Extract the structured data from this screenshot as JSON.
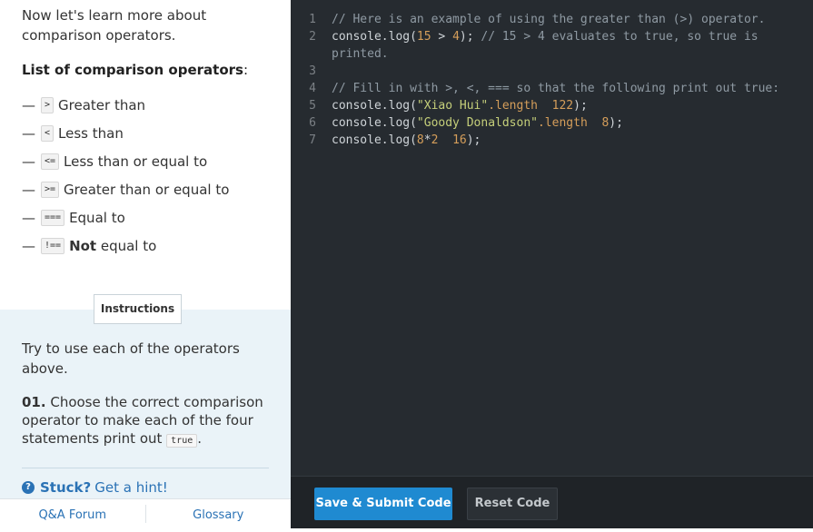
{
  "lesson": {
    "intro": "Now let's learn more about comparison operators.",
    "list_title": "List of comparison operators",
    "list_title_colon": ":",
    "operators": [
      {
        "symbol": ">",
        "label": "Greater than"
      },
      {
        "symbol": "<",
        "label": "Less than"
      },
      {
        "symbol": "<=",
        "label": "Less than or equal to"
      },
      {
        "symbol": ">=",
        "label": "Greater than or equal to"
      },
      {
        "symbol": "===",
        "label": "Equal to"
      },
      {
        "symbol": "!==",
        "label_bold": "Not",
        "label": " equal to"
      }
    ]
  },
  "instructions": {
    "tab_label": "Instructions",
    "text": "Try to use each of the operators above.",
    "step_number": "01.",
    "step_text": " Choose the correct comparison operator to make each of the four statements print out ",
    "step_code": "true",
    "step_end": "."
  },
  "hint": {
    "icon": "?",
    "bold": "Stuck?",
    "text": "Get a hint!"
  },
  "footer": {
    "qa_label": "Q&A Forum",
    "glossary_label": "Glossary"
  },
  "editor": {
    "lines": [
      {
        "n": "1",
        "tokens": [
          {
            "t": "// Here is an example of using the greater than (>) operator.",
            "c": "c-com"
          }
        ]
      },
      {
        "n": "2",
        "tokens": [
          {
            "t": "console.log(",
            "c": "c-fn"
          },
          {
            "t": "15",
            "c": "c-num"
          },
          {
            "t": " > ",
            "c": "c-fn"
          },
          {
            "t": "4",
            "c": "c-num"
          },
          {
            "t": "); ",
            "c": "c-fn"
          },
          {
            "t": "// 15 > 4 evaluates to true, so true is",
            "c": "c-com"
          }
        ]
      },
      {
        "n": "",
        "tokens": [
          {
            "t": "printed.",
            "c": "c-com"
          }
        ]
      },
      {
        "n": "3",
        "tokens": [
          {
            "t": "",
            "c": "c-fn"
          }
        ]
      },
      {
        "n": "4",
        "tokens": [
          {
            "t": "// Fill in with >, <, === so that the following print out true:",
            "c": "c-com"
          }
        ]
      },
      {
        "n": "5",
        "tokens": [
          {
            "t": "console.log(",
            "c": "c-fn"
          },
          {
            "t": "\"Xiao Hui\"",
            "c": "c-str"
          },
          {
            "t": ".length",
            "c": "c-prop"
          },
          {
            "t": "  ",
            "c": "c-fn"
          },
          {
            "t": "122",
            "c": "c-num"
          },
          {
            "t": ");",
            "c": "c-fn"
          }
        ]
      },
      {
        "n": "6",
        "tokens": [
          {
            "t": "console.log(",
            "c": "c-fn"
          },
          {
            "t": "\"Goody Donaldson\"",
            "c": "c-str"
          },
          {
            "t": ".length",
            "c": "c-prop"
          },
          {
            "t": "  ",
            "c": "c-fn"
          },
          {
            "t": "8",
            "c": "c-num"
          },
          {
            "t": ");",
            "c": "c-fn"
          }
        ]
      },
      {
        "n": "7",
        "tokens": [
          {
            "t": "console.log(",
            "c": "c-fn"
          },
          {
            "t": "8",
            "c": "c-num"
          },
          {
            "t": "*",
            "c": "c-fn"
          },
          {
            "t": "2",
            "c": "c-num"
          },
          {
            "t": "  ",
            "c": "c-fn"
          },
          {
            "t": "16",
            "c": "c-num"
          },
          {
            "t": ");",
            "c": "c-fn"
          }
        ]
      }
    ]
  },
  "toolbar": {
    "submit_label": "Save & Submit Code",
    "reset_label": "Reset Code"
  },
  "colors": {
    "accent": "#1f8ad1",
    "link": "#2a72b5",
    "editor_bg": "#262b30"
  }
}
